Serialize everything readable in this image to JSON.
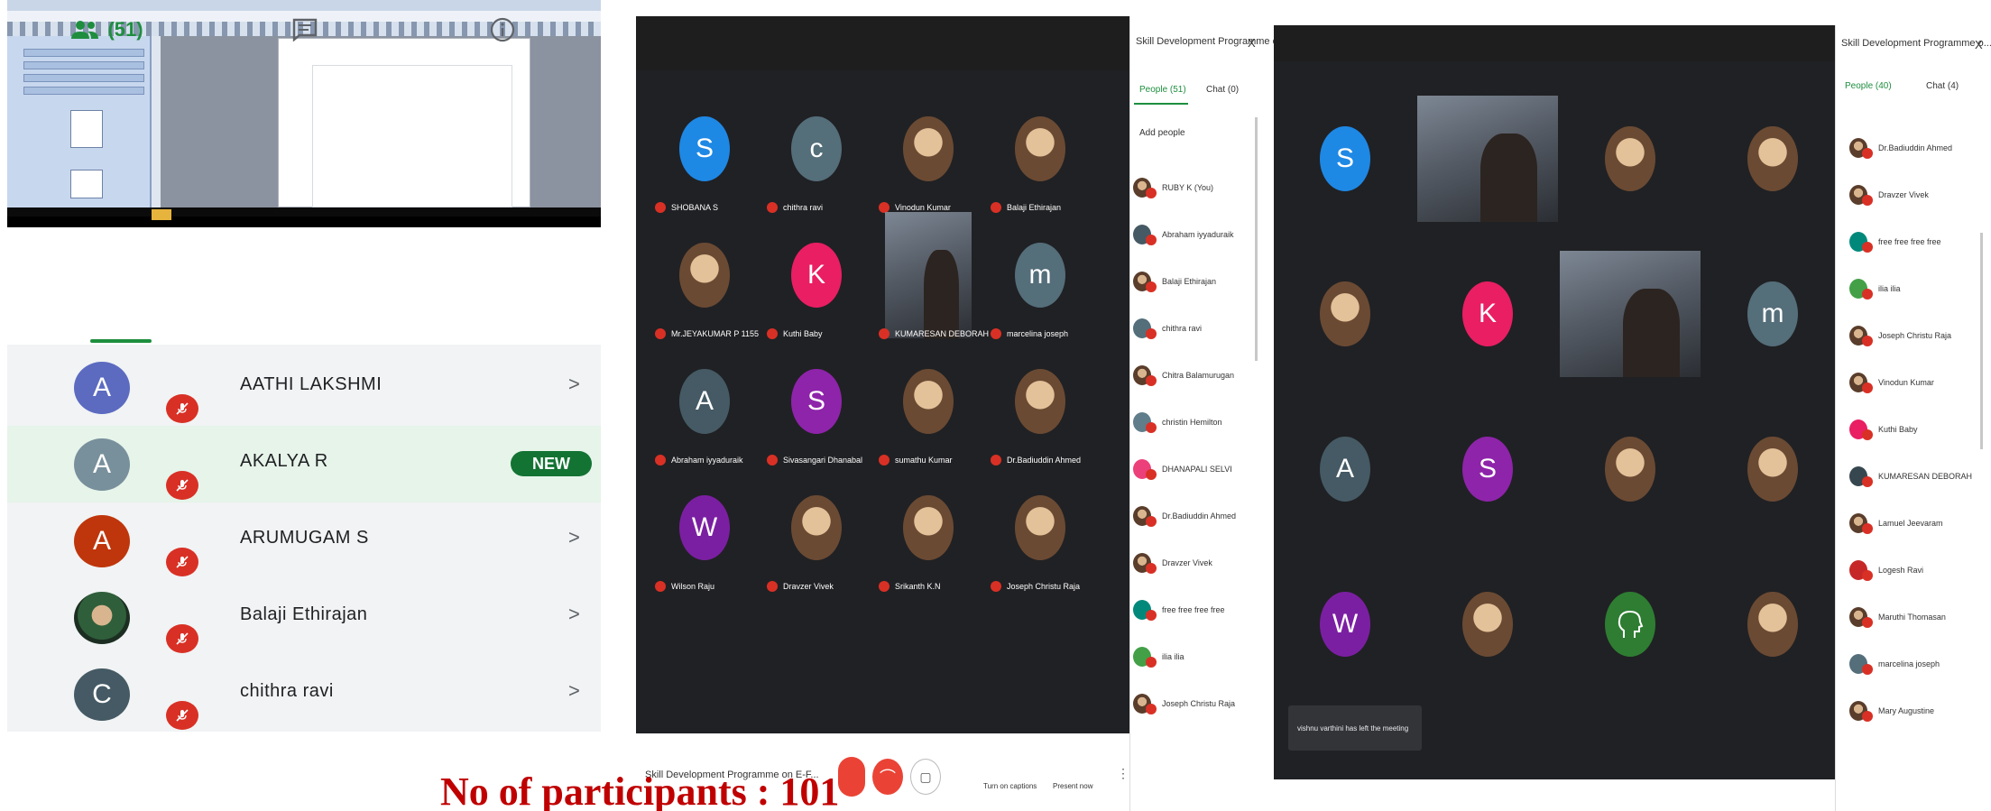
{
  "caption": "No of participants : 101",
  "colors": {
    "meet_green": "#1e8e3e",
    "mute_red": "#d93025",
    "new_badge": "#137333",
    "caption_red": "#c00000",
    "meet_dark": "#202124"
  },
  "mobile_panel": {
    "people_count": "(51)",
    "icons": {
      "people": "people-icon",
      "chat": "chat-icon",
      "info": "info-icon"
    },
    "participants": [
      {
        "initial": "A",
        "name": "AATHI LAKSHMI",
        "color": "#5c6bc0",
        "action": ">",
        "highlight": false
      },
      {
        "initial": "A",
        "name": "AKALYA R",
        "color": "#78909c",
        "badge": "NEW",
        "highlight": true
      },
      {
        "initial": "A",
        "name": "ARUMUGAM S",
        "color": "#bf360c",
        "action": ">",
        "highlight": false
      },
      {
        "initial": "",
        "name": "Balaji Ethirajan",
        "photo": true,
        "action": ">",
        "highlight": false
      },
      {
        "initial": "C",
        "name": "chithra ravi",
        "color": "#455a64",
        "action": ">",
        "highlight": false
      }
    ]
  },
  "meet_panel_middle": {
    "tiles": [
      {
        "initial": "S",
        "color": "#1e88e5",
        "label": "SHOBANA S"
      },
      {
        "initial": "c",
        "color": "#546e7a",
        "label": "chithra ravi"
      },
      {
        "initial": "",
        "photo": true,
        "label": "Vinodun Kumar"
      },
      {
        "initial": "",
        "photo": true,
        "label": "Balaji Ethirajan"
      },
      {
        "initial": "",
        "photo": true,
        "label": "Mr.JEYAKUMAR P 1155"
      },
      {
        "initial": "K",
        "color": "#e91e63",
        "label": "Kuthi Baby"
      },
      {
        "initial": "",
        "video": true,
        "label": "KUMARESAN DEBORAH"
      },
      {
        "initial": "m",
        "color": "#546e7a",
        "label": "marcelina joseph"
      },
      {
        "initial": "A",
        "color": "#455a64",
        "label": "Abraham iyyaduraik"
      },
      {
        "initial": "S",
        "color": "#8e24aa",
        "label": "Sivasangari Dhanabal"
      },
      {
        "initial": "",
        "photo": true,
        "label": "sumathu Kumar"
      },
      {
        "initial": "",
        "photo": true,
        "label": "Dr.Badiuddin Ahmed"
      },
      {
        "initial": "W",
        "color": "#7b1fa2",
        "label": "Wilson Raju"
      },
      {
        "initial": "",
        "photo": true,
        "label": "Dravzer Vivek"
      },
      {
        "initial": "",
        "photo": true,
        "label": "Srikanth K.N"
      },
      {
        "initial": "",
        "photo": true,
        "label": "Joseph Christu Raja"
      }
    ],
    "sidebar": {
      "title": "Skill Development Programme o...",
      "close": "X",
      "people_tab": "People (51)",
      "chat_tab": "Chat (0)",
      "add_people": "Add people",
      "items": [
        {
          "name": "RUBY K (You)",
          "photo": true
        },
        {
          "name": "Abraham iyyaduraik",
          "color": "#455a64"
        },
        {
          "name": "Balaji Ethirajan",
          "photo": true
        },
        {
          "name": "chithra ravi",
          "color": "#546e7a"
        },
        {
          "name": "Chitra Balamurugan",
          "photo": true
        },
        {
          "name": "christin Hemilton",
          "color": "#607d8b"
        },
        {
          "name": "DHANAPALI SELVI",
          "color": "#ec407a"
        },
        {
          "name": "Dr.Badiuddin Ahmed",
          "photo": true
        },
        {
          "name": "Dravzer Vivek",
          "photo": true
        },
        {
          "name": "free free free free",
          "color": "#00897b"
        },
        {
          "name": "ilia ilia",
          "color": "#43a047"
        },
        {
          "name": "Joseph Christu Raja",
          "photo": true
        }
      ]
    },
    "bottom_bar": {
      "meeting_name": "Skill Development Programme on E-F...",
      "captions": "Turn on captions",
      "present": "Present now"
    }
  },
  "meet_panel_right": {
    "toast": "vishnu varthini has left the meeting",
    "tiles": [
      {
        "initial": "S",
        "color": "#1e88e5"
      },
      {
        "initial": "",
        "video": true
      },
      {
        "initial": "",
        "photo": true
      },
      {
        "initial": "",
        "photo": true
      },
      {
        "initial": "",
        "photo": true
      },
      {
        "initial": "K",
        "color": "#e91e63"
      },
      {
        "initial": "",
        "video": true
      },
      {
        "initial": "m",
        "color": "#546e7a"
      },
      {
        "initial": "A",
        "color": "#455a64"
      },
      {
        "initial": "S",
        "color": "#8e24aa"
      },
      {
        "initial": "",
        "photo": true
      },
      {
        "initial": "",
        "photo": true
      },
      {
        "initial": "W",
        "color": "#7b1fa2"
      },
      {
        "initial": "",
        "photo": true
      },
      {
        "initial": "",
        "head_icon": true,
        "color": "#2e7d32"
      },
      {
        "initial": "",
        "photo": true
      }
    ],
    "sidebar": {
      "title": "Skill Development Programme o...",
      "close": "X",
      "people_tab": "People (40)",
      "chat_tab": "Chat (4)",
      "items": [
        {
          "name": "Dr.Badiuddin Ahmed",
          "photo": true
        },
        {
          "name": "Dravzer Vivek",
          "photo": true
        },
        {
          "name": "free free free free",
          "color": "#00897b"
        },
        {
          "name": "ilia ilia",
          "color": "#43a047"
        },
        {
          "name": "Joseph Christu Raja",
          "photo": true
        },
        {
          "name": "Vinodun Kumar",
          "photo": true
        },
        {
          "name": "Kuthi Baby",
          "color": "#e91e63"
        },
        {
          "name": "KUMARESAN DEBORAH",
          "color": "#37474f"
        },
        {
          "name": "Lamuel Jeevaram",
          "photo": true
        },
        {
          "name": "Logesh Ravi",
          "color": "#c62828"
        },
        {
          "name": "Maruthi Thomasan",
          "photo": true
        },
        {
          "name": "marcelina joseph",
          "color": "#546e7a"
        },
        {
          "name": "Mary Augustine",
          "photo": true
        }
      ]
    }
  }
}
